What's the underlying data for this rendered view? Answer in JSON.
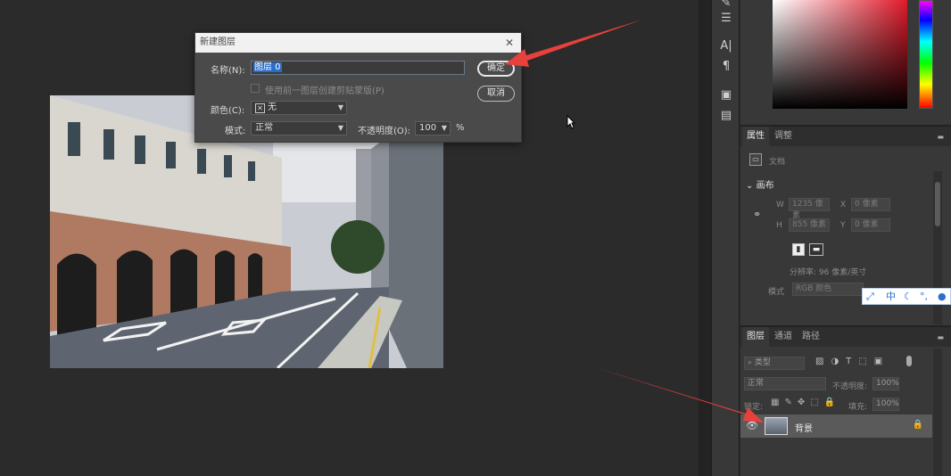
{
  "dialog": {
    "title": "新建图层",
    "close_icon": "close-icon",
    "name_label": "名称(N):",
    "name_value": "图层 0",
    "checkbox_label": "使用前一图层创建剪贴蒙版(P)",
    "color_label": "颜色(C):",
    "color_value": "无",
    "mode_label": "模式:",
    "mode_value": "正常",
    "opacity_label": "不透明度(O):",
    "opacity_value": "100",
    "opacity_unit": "%",
    "ok_label": "确定",
    "cancel_label": "取消"
  },
  "properties_panel": {
    "tabs": [
      "属性",
      "调整"
    ],
    "doc_label": "文档",
    "section_title": "画布",
    "w_label": "W",
    "w_value": "1235 像素",
    "h_label": "H",
    "h_value": "855 像素",
    "x_label": "X",
    "x_value": "0 像素",
    "y_label": "Y",
    "y_value": "0 像素",
    "resolution": "分辨率: 96 像素/英寸",
    "mode_label": "模式",
    "mode_value": "RGB 颜色"
  },
  "ime": {
    "items": [
      "中"
    ]
  },
  "layers_panel": {
    "tabs": [
      "图层",
      "通道",
      "路径"
    ],
    "filter_kind": "类型",
    "blend_mode": "正常",
    "opacity_label": "不透明度:",
    "opacity_value": "100%",
    "lock_label": "锁定:",
    "fill_label": "填充:",
    "fill_value": "100%",
    "layer_name": "背景"
  },
  "colors": {
    "accent_arrow": "#e8413c",
    "selection": "#2a6dc7"
  }
}
